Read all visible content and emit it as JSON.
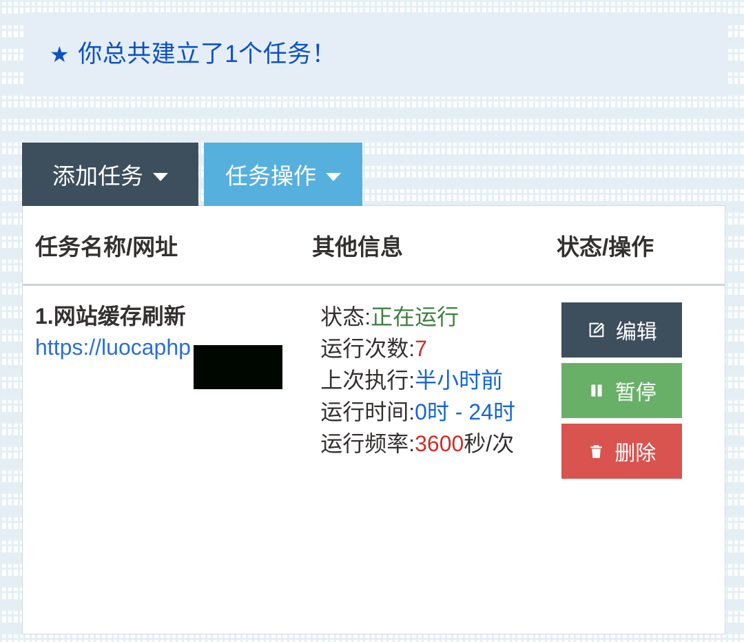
{
  "alert": {
    "icon": "star-icon",
    "star_glyph": "★",
    "message": "你总共建立了1个任务！",
    "text_color": "#0b51c5",
    "bg_color": "#e5eef6"
  },
  "toolbar": {
    "add_task_label": "添加任务",
    "add_task_color": "#3d4e5d",
    "task_ops_label": "任务操作",
    "task_ops_color": "#56b0de",
    "caret_icon": "chevron-down-icon"
  },
  "table": {
    "headers": [
      "任务名称/网址",
      "其他信息",
      "状态/操作"
    ],
    "rows": [
      {
        "title": "1.网站缓存刷新",
        "url_visible_prefix": "https://luoca",
        "url_visible_suffix": "php",
        "url_redacted": true,
        "info": [
          {
            "label": "状态:",
            "value": "正在运行",
            "value_color": "#3f7f3f"
          },
          {
            "label": "运行次数:",
            "value": "7",
            "value_color": "#c9302c"
          },
          {
            "label": "上次执行:",
            "value": "半小时前",
            "value_color": "#1565d8"
          },
          {
            "label": "运行时间:",
            "value": "0时 - 24时",
            "value_color": "#1565d8"
          },
          {
            "label": "运行频率:",
            "value": "3600",
            "value_color": "#c9302c",
            "suffix": "秒/次"
          }
        ],
        "actions": [
          {
            "label": "编辑",
            "icon": "pencil-square-icon",
            "color": "#3d4e5d"
          },
          {
            "label": "暂停",
            "icon": "pause-icon",
            "color": "#68b068"
          },
          {
            "label": "删除",
            "icon": "trash-icon",
            "color": "#d9534f"
          }
        ]
      }
    ]
  }
}
